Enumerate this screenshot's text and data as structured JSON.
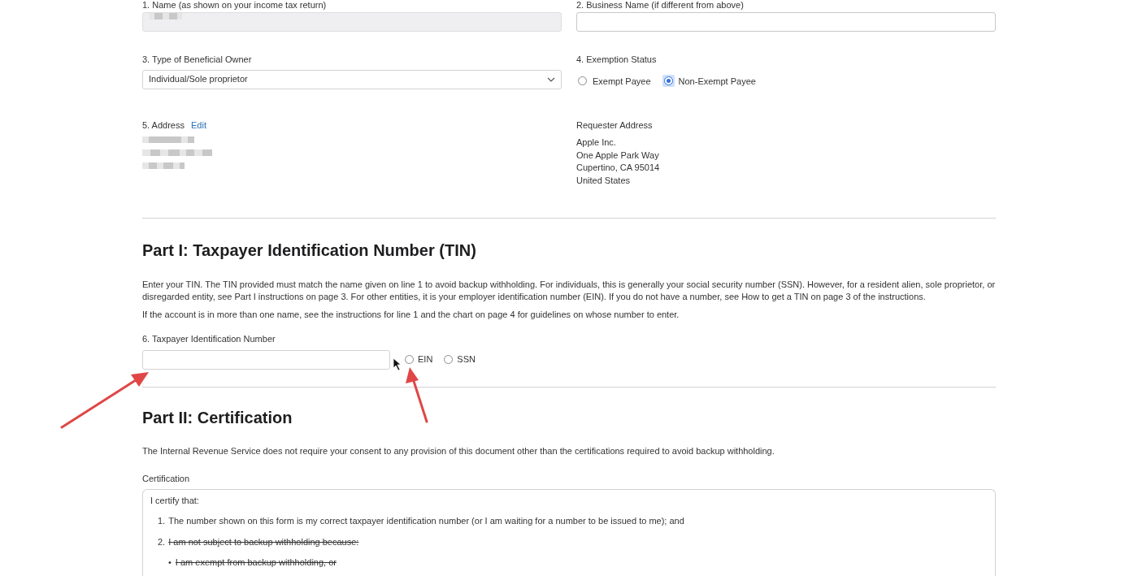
{
  "top_fields": [
    {
      "label": "1. Name (as shown on your income tax return)",
      "redacted": true,
      "disabled": true
    },
    {
      "label": "2. Business Name (if different from above)",
      "redacted": false,
      "disabled": false
    }
  ],
  "beneficial_owner": {
    "label": "3. Type of Beneficial Owner",
    "value": "Individual/Sole proprietor"
  },
  "exemption": {
    "label": "4. Exemption Status",
    "options": [
      {
        "label": "Exempt Payee",
        "selected": false
      },
      {
        "label": "Non-Exempt Payee",
        "selected": true
      }
    ]
  },
  "address": {
    "label": "5. Address",
    "edit_link": "Edit"
  },
  "requester": {
    "label": "Requester Address",
    "lines": [
      "Apple Inc.",
      "One Apple Park Way",
      "Cupertino, CA 95014",
      "United States"
    ]
  },
  "part1": {
    "title": "Part I: Taxpayer Identification Number (TIN)",
    "paragraphs": [
      "Enter your TIN. The TIN provided must match the name given on line 1 to avoid backup withholding. For individuals, this is generally your social security number (SSN). However, for a resident alien, sole proprietor, or disregarded entity, see Part I instructions on page 3. For other entities, it is your employer identification number (EIN). If you do not have a number, see How to get a TIN on page 3 of the instructions.",
      "If the account is in more than one name, see the instructions for line 1 and the chart on page 4 for guidelines on whose number to enter."
    ],
    "tin_label": "6. Taxpayer Identification Number",
    "tin_types": [
      {
        "label": "EIN",
        "selected": false
      },
      {
        "label": "SSN",
        "selected": false
      }
    ]
  },
  "part2": {
    "title": "Part II: Certification",
    "paragraph": "The Internal Revenue Service does not require your consent to any provision of this document other than the certifications required to avoid backup withholding.",
    "cert_label": "Certification",
    "intro": "I certify that:",
    "items": [
      {
        "kind": "numbered",
        "marker": "1.",
        "text": "The number shown on this form is my correct taxpayer identification number (or I am waiting for a number to be issued to me); and",
        "struck": false
      },
      {
        "kind": "numbered",
        "marker": "2.",
        "text": "I am not subject to backup withholding because:",
        "struck": true
      },
      {
        "kind": "bullet",
        "marker": "•",
        "text": "I am exempt from backup withholding, or",
        "struck": true
      }
    ]
  }
}
